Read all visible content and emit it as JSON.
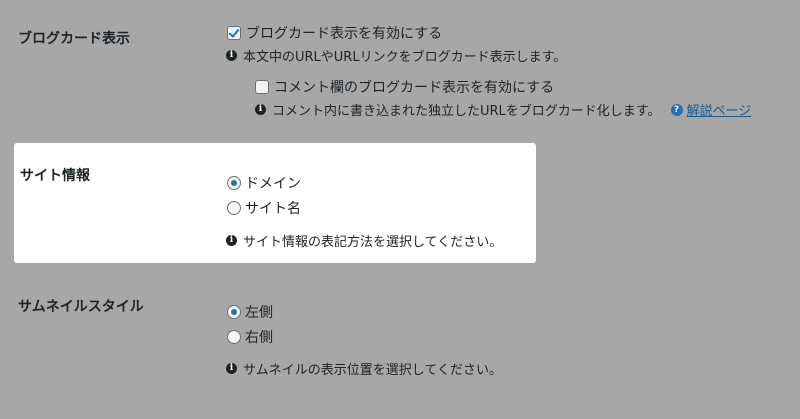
{
  "blogcard": {
    "label": "ブログカード表示",
    "enable_label": "ブログカード表示を有効にする",
    "enable_checked": true,
    "enable_desc": "本文中のURLやURLリンクをブログカード表示します。",
    "comment_label": "コメント欄のブログカード表示を有効にする",
    "comment_checked": false,
    "comment_desc": "コメント内に書き込まれた独立したURLをブログカード化します。",
    "help_link": "解説ページ"
  },
  "site_info": {
    "label": "サイト情報",
    "options": [
      {
        "label": "ドメイン",
        "checked": true
      },
      {
        "label": "サイト名",
        "checked": false
      }
    ],
    "desc": "サイト情報の表記方法を選択してください。"
  },
  "thumbnail_style": {
    "label": "サムネイルスタイル",
    "options": [
      {
        "label": "左側",
        "checked": true
      },
      {
        "label": "右側",
        "checked": false
      }
    ],
    "desc": "サムネイルの表示位置を選択してください。"
  },
  "icons": {
    "info": "info-icon",
    "help": "question-icon",
    "info_glyph": "i",
    "help_glyph": "?"
  },
  "colors": {
    "background": "#a7a7a7",
    "panel": "#ffffff",
    "accent": "#2271b1",
    "text": "#1d2327"
  }
}
